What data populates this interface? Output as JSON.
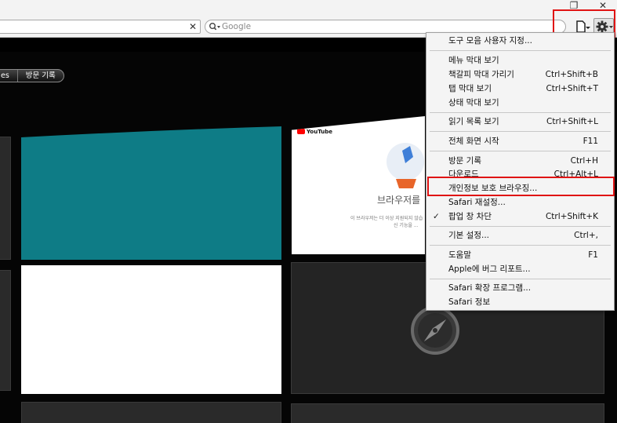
{
  "window": {
    "restore_glyph": "❐",
    "close_glyph": "✕"
  },
  "toolbar": {
    "address_clear_glyph": "✕",
    "search_placeholder": "Google",
    "page_icon": "page-icon",
    "gear_icon": "gear-icon"
  },
  "topsites": {
    "segment_left": "es",
    "segment_history": "방문 기록",
    "youtube_logo": "YouTube",
    "youtube_title": "브라우저를",
    "youtube_sub": "이 브라우저는 더 이상 지원되지 않습",
    "youtube_sub2": "신 기능을 ..."
  },
  "menu": {
    "items": [
      {
        "label": "도구 모음 사용자 지정...",
        "shortcut": ""
      },
      {
        "label": "메뉴 막대 보기",
        "shortcut": ""
      },
      {
        "label": "책갈피 막대 가리기",
        "shortcut": "Ctrl+Shift+B"
      },
      {
        "label": "탭 막대 보기",
        "shortcut": "Ctrl+Shift+T"
      },
      {
        "label": "상태 막대 보기",
        "shortcut": ""
      },
      {
        "label": "읽기 목록 보기",
        "shortcut": "Ctrl+Shift+L"
      },
      {
        "label": "전체 화면 시작",
        "shortcut": "F11"
      },
      {
        "label": "방문 기록",
        "shortcut": "Ctrl+H"
      },
      {
        "label": "다운로드",
        "shortcut": "Ctrl+Alt+L"
      },
      {
        "label": "개인정보 보호 브라우징...",
        "shortcut": ""
      },
      {
        "label": "Safari 재설정...",
        "shortcut": ""
      },
      {
        "label": "팝업 창 차단",
        "shortcut": "Ctrl+Shift+K",
        "checked": "✓"
      },
      {
        "label": "기본 설정...",
        "shortcut": "Ctrl+,"
      },
      {
        "label": "도움말",
        "shortcut": "F1"
      },
      {
        "label": "Apple에 버그 리포트...",
        "shortcut": ""
      },
      {
        "label": "Safari 확장 프로그램...",
        "shortcut": ""
      },
      {
        "label": "Safari 정보",
        "shortcut": ""
      }
    ]
  },
  "colors": {
    "highlight": "#e01414",
    "teal_tile": "#0e7c86"
  }
}
